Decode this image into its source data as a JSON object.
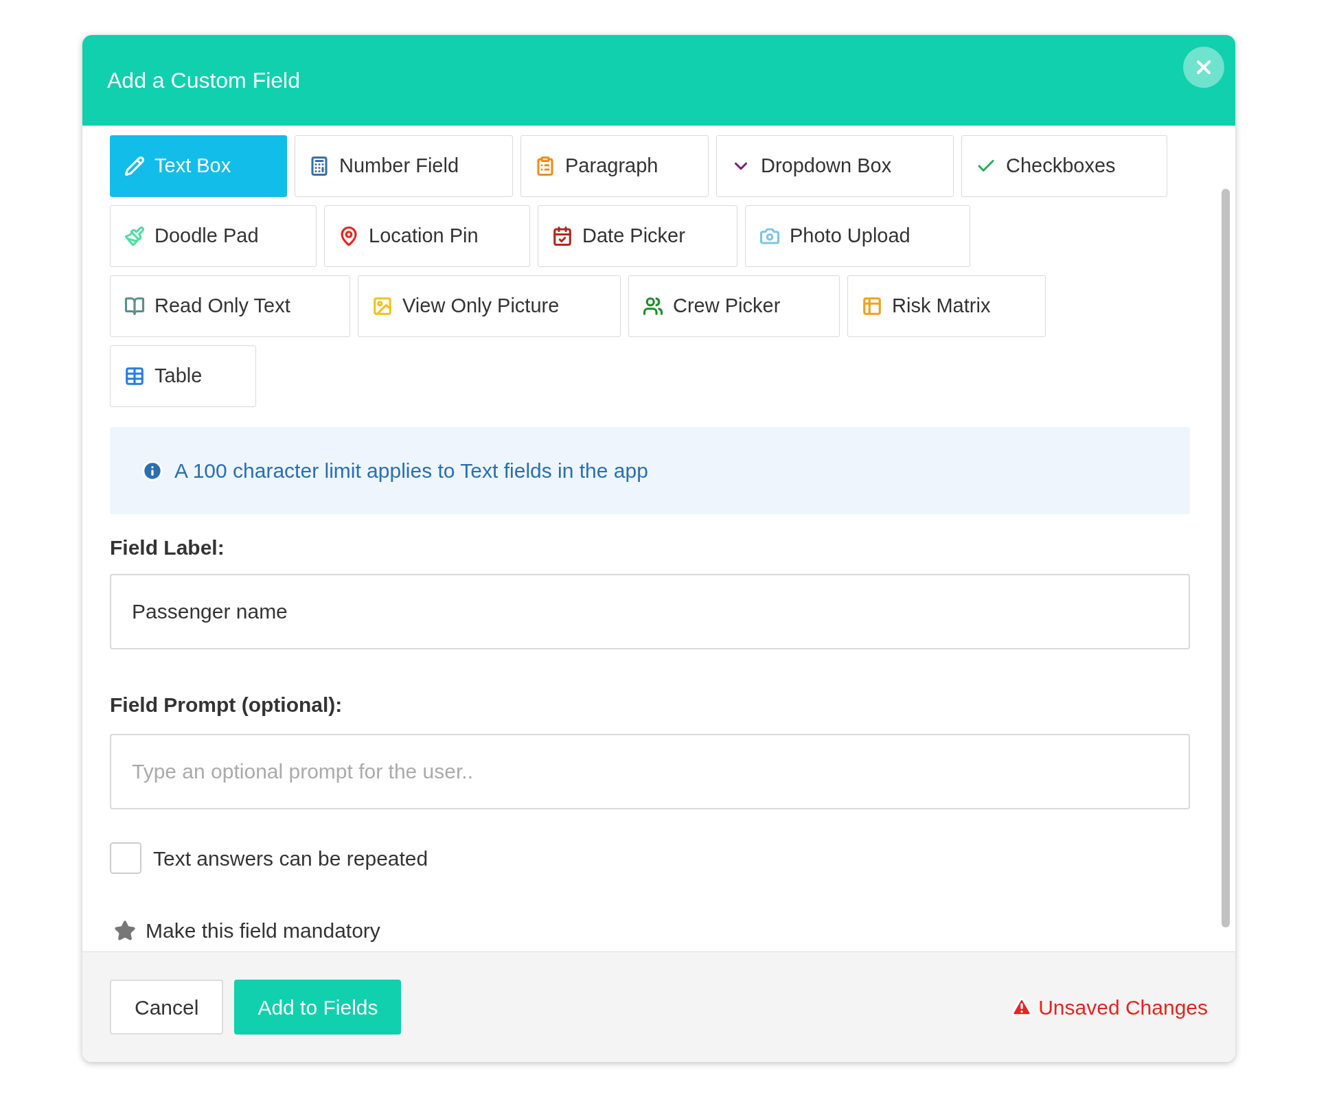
{
  "dialog": {
    "title": "Add a Custom Field"
  },
  "field_types": [
    {
      "label": "Text Box",
      "selected": true
    },
    {
      "label": "Number Field",
      "selected": false
    },
    {
      "label": "Paragraph",
      "selected": false
    },
    {
      "label": "Dropdown Box",
      "selected": false
    },
    {
      "label": "Checkboxes",
      "selected": false
    },
    {
      "label": "Doodle Pad",
      "selected": false
    },
    {
      "label": "Location Pin",
      "selected": false
    },
    {
      "label": "Date Picker",
      "selected": false
    },
    {
      "label": "Photo Upload",
      "selected": false
    },
    {
      "label": "Read Only Text",
      "selected": false
    },
    {
      "label": "View Only Picture",
      "selected": false
    },
    {
      "label": "Crew Picker",
      "selected": false
    },
    {
      "label": "Risk Matrix",
      "selected": false
    },
    {
      "label": "Table",
      "selected": false
    }
  ],
  "info": {
    "text": "A 100 character limit applies to Text fields in the app"
  },
  "field_label": {
    "label": "Field Label:",
    "value": "Passenger name"
  },
  "field_prompt": {
    "label": "Field Prompt (optional):",
    "placeholder": "Type an optional prompt for the user.."
  },
  "repeat_option": {
    "label": "Text answers can be repeated",
    "checked": false
  },
  "mandatory_option": {
    "label": "Make this field mandatory",
    "on": false
  },
  "footer": {
    "cancel": "Cancel",
    "submit": "Add to Fields",
    "status": "Unsaved Changes"
  }
}
